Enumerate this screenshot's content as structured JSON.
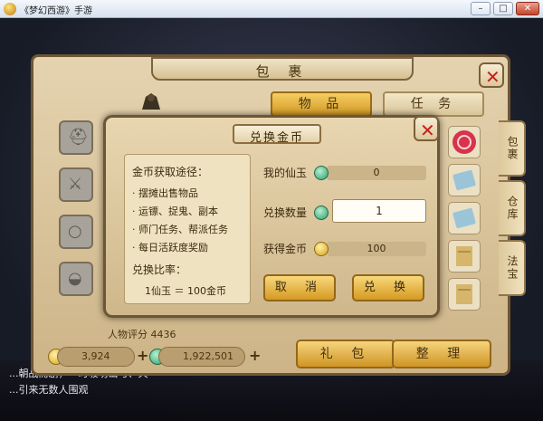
{
  "window": {
    "title": "《梦幻西游》手游",
    "min": "–",
    "max": "□",
    "close": "✕"
  },
  "bag": {
    "title": "包 裹",
    "tabs": [
      "物 品",
      "任 务"
    ],
    "side_tabs": [
      "包裹",
      "仓库",
      "法宝"
    ],
    "score_label": "人物评分",
    "score_value": "4436",
    "gold_value": "3,924",
    "silver_value": "1,922,501",
    "bottom_buttons": [
      "礼 包",
      "整 理"
    ]
  },
  "dialog": {
    "title": "兑换金币",
    "info_heading": "金币获取途径：",
    "info_items": [
      "· 摆摊出售物品",
      "· 运镖、捉鬼、副本",
      "· 师门任务、帮派任务",
      "· 每日活跃度奖励"
    ],
    "ratio_heading": "兑换比率：",
    "ratio_text": "1仙玉 ＝ 100金币",
    "rows": [
      {
        "label": "我的仙玉",
        "value": "0"
      },
      {
        "label": "兑换数量",
        "value": "1"
      },
      {
        "label": "获得金币",
        "value": "100"
      }
    ],
    "cancel": "取 消",
    "confirm": "兑 换"
  },
  "chat": [
    "...朝战而剧，一时吸功山与、天",
    "...引来无数人围观"
  ],
  "colors": {
    "accent": "#d39a25",
    "close_red": "#c8201a",
    "jade": "#2d9e6a",
    "coin": "#d8a21b"
  },
  "icons": [
    "jade-icon",
    "gold-coin-icon",
    "close-icon",
    "helmet-icon",
    "sword-icon",
    "necklace-icon",
    "armor-icon"
  ]
}
